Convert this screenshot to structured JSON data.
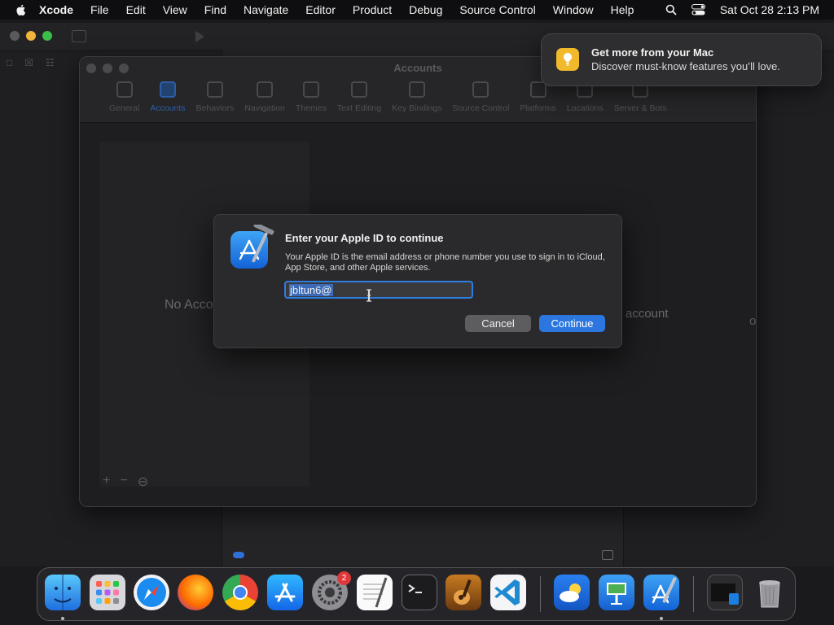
{
  "menubar": {
    "app_name": "Xcode",
    "items": [
      "File",
      "Edit",
      "View",
      "Find",
      "Navigate",
      "Editor",
      "Product",
      "Debug",
      "Source Control",
      "Window",
      "Help"
    ],
    "clock": "Sat Oct 28  2:13 PM"
  },
  "accounts_window": {
    "title": "Accounts",
    "tabs": [
      "General",
      "Accounts",
      "Behaviors",
      "Navigation",
      "Themes",
      "Text Editing",
      "Key Bindings",
      "Source Control",
      "Platforms",
      "Locations",
      "Server & Bots"
    ],
    "active_tab": "Accounts",
    "no_accounts_text": "No Acco",
    "hint_text": "account",
    "hint_text_2": "on"
  },
  "dialog": {
    "title": "Enter your Apple ID to continue",
    "body": "Your Apple ID is the email address or phone number you use to sign in to iCloud, App Store, and other Apple services.",
    "input_value": "jbltun6@",
    "cancel_label": "Cancel",
    "continue_label": "Continue"
  },
  "notification": {
    "title": "Get more from your Mac",
    "body": "Discover must-know features you’ll love."
  },
  "dock": {
    "settings_badge": "2"
  },
  "colors": {
    "accent": "#2c76e0",
    "focus_ring": "#2d7de0",
    "notification_icon": "#f2b92b",
    "badge": "#e0383a"
  }
}
